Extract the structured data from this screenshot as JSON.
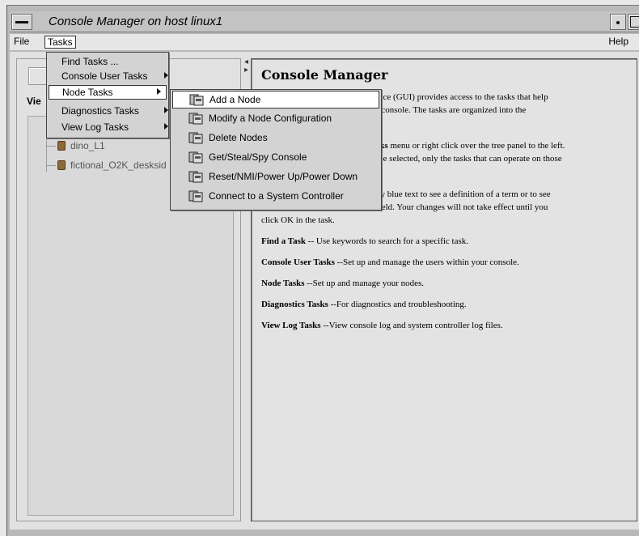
{
  "window": {
    "title": "Console Manager on host linux1"
  },
  "menubar": {
    "file": "File",
    "tasks": "Tasks",
    "help": "Help"
  },
  "left_pane": {
    "view_label": "Vie",
    "tree_items": [
      "dino_L1",
      "fictional_O2K_desksid"
    ]
  },
  "tasks_menu": {
    "items": [
      {
        "label": "Find Tasks ..."
      },
      {
        "label": "Console User Tasks"
      },
      {
        "label": "Node Tasks"
      },
      {
        "label": "Diagnostics Tasks"
      },
      {
        "label": "View Log Tasks"
      }
    ]
  },
  "node_submenu": {
    "items": [
      {
        "label": "Add a Node"
      },
      {
        "label": "Modify a Node Configuration"
      },
      {
        "label": "Delete Nodes"
      },
      {
        "label": "Get/Steal/Spy Console"
      },
      {
        "label": "Reset/NMI/Power Up/Power Down"
      },
      {
        "label": "Connect to a System Controller"
      }
    ]
  },
  "right_pane": {
    "title": "Console Manager",
    "line1": "face (GUI) provides access to the tasks that help",
    "line2": "r console.  The tasks are organized into the",
    "line3a": "sks",
    "line3b": " menu or right click over the tree panel to the left.",
    "line4": "ree selected, only the tasks that can operate on those",
    "line5": "ny blue text to see a definition of a term or to see",
    "line6": "field.  Your changes will not take effect until you",
    "line7": "click OK in the task.",
    "find_b": "Find a Task",
    "find_t": " -- Use keywords to search for a specific task.",
    "cu_b": "Console User Tasks",
    "cu_t": " --Set up and manage the users within your console.",
    "node_b": "Node Tasks",
    "node_t": " --Set up and manage your nodes.",
    "diag_b": "Diagnostics Tasks",
    "diag_t": " --For diagnostics and troubleshooting.",
    "log_b": "View Log Tasks",
    "log_t": " --View console log and system controller log files."
  }
}
